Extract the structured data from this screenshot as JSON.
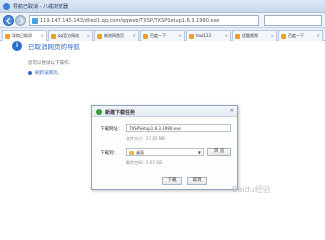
{
  "window": {
    "title": "导航已取消 - 八戒浏览器"
  },
  "address_bar": {
    "url": "119.147.145.143/dlied1.qq.com/qqweb/TXSP/TXSPSetup1.6.3.1990.exe"
  },
  "tabs": [
    {
      "label": "导航已取消",
      "active": true
    },
    {
      "label": "qq官方网站"
    },
    {
      "label": "新浪网首页"
    },
    {
      "label": "百度一下"
    },
    {
      "label": "hao123"
    },
    {
      "label": "优酷视频"
    },
    {
      "label": "百度一下"
    }
  ],
  "page": {
    "heading": "已取消网页的导航",
    "sub": "您可以尝试以下操作：",
    "link": "刷新该网页。"
  },
  "dialog": {
    "title": "新建下载任务",
    "url_label": "下载网址：",
    "url_value": "TXSPSetup1.6.3.1990.exe",
    "size_text": "文件大小：27.65 MB",
    "save_label": "下载到：",
    "save_value": "桌面",
    "browse_button": "浏 览",
    "free_text": "剩余空间：2.67 GB",
    "download_button": "下载",
    "cancel_button": "取消"
  },
  "watermark": "Baidu经验",
  "colors": {
    "accent": "#2b6bbf",
    "dialog_border": "#8fa4bf"
  }
}
